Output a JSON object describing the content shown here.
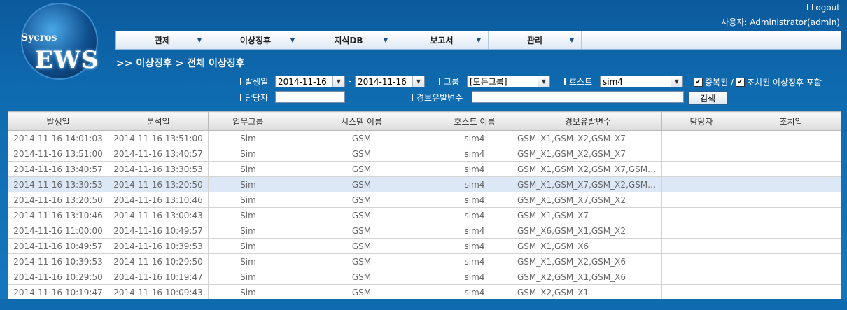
{
  "logo": {
    "sycros": "Sycros",
    "ews": "EWS"
  },
  "top": {
    "logout": "Logout",
    "user": "사용자: Administrator(admin)"
  },
  "menu": [
    "관제",
    "이상징후",
    "지식DB",
    "보고서",
    "관리"
  ],
  "breadcrumb": ">> 이상징후 > 전체 이상징후",
  "filters": {
    "date_label": "발생일",
    "date_from": "2014-11-16",
    "date_to": "2014-11-16",
    "group_label": "그룹",
    "group_value": "[모든그룹]",
    "host_label": "호스트",
    "host_value": "sim4",
    "dup_label": "중복된 /",
    "handled_label": "조치된 이상징후 포함",
    "owner_label": "담당자",
    "var_label": "경보유발변수",
    "search_button": "검색"
  },
  "table": {
    "headers": [
      "발생일",
      "분석일",
      "업무그룹",
      "시스템 이름",
      "호스트 이름",
      "경보유발변수",
      "담당자",
      "조치일"
    ],
    "rows": [
      [
        "2014-11-16 14:01:03",
        "2014-11-16 13:51:00",
        "Sim",
        "GSM",
        "sim4",
        "GSM_X1,GSM_X2,GSM_X7",
        "",
        ""
      ],
      [
        "2014-11-16 13:51:00",
        "2014-11-16 13:40:57",
        "Sim",
        "GSM",
        "sim4",
        "GSM_X1,GSM_X2,GSM_X7",
        "",
        ""
      ],
      [
        "2014-11-16 13:40:57",
        "2014-11-16 13:30:53",
        "Sim",
        "GSM",
        "sim4",
        "GSM_X1,GSM_X2,GSM_X7,GSM_X...",
        "",
        ""
      ],
      [
        "2014-11-16 13:30:53",
        "2014-11-16 13:20:50",
        "Sim",
        "GSM",
        "sim4",
        "GSM_X1,GSM_X7,GSM_X2,GSM_X...",
        "",
        ""
      ],
      [
        "2014-11-16 13:20:50",
        "2014-11-16 13:10:46",
        "Sim",
        "GSM",
        "sim4",
        "GSM_X1,GSM_X7,GSM_X2",
        "",
        ""
      ],
      [
        "2014-11-16 13:10:46",
        "2014-11-16 13:00:43",
        "Sim",
        "GSM",
        "sim4",
        "GSM_X1,GSM_X7",
        "",
        ""
      ],
      [
        "2014-11-16 11:00:00",
        "2014-11-16 10:49:57",
        "Sim",
        "GSM",
        "sim4",
        "GSM_X6,GSM_X1,GSM_X2",
        "",
        ""
      ],
      [
        "2014-11-16 10:49:57",
        "2014-11-16 10:39:53",
        "Sim",
        "GSM",
        "sim4",
        "GSM_X1,GSM_X6",
        "",
        ""
      ],
      [
        "2014-11-16 10:39:53",
        "2014-11-16 10:29:50",
        "Sim",
        "GSM",
        "sim4",
        "GSM_X1,GSM_X2,GSM_X6",
        "",
        ""
      ],
      [
        "2014-11-16 10:29:50",
        "2014-11-16 10:19:47",
        "Sim",
        "GSM",
        "sim4",
        "GSM_X2,GSM_X1,GSM_X6",
        "",
        ""
      ],
      [
        "2014-11-16 10:19:47",
        "2014-11-16 10:09:43",
        "Sim",
        "GSM",
        "sim4",
        "GSM_X2,GSM_X1",
        "",
        ""
      ]
    ],
    "highlight_row": 3
  }
}
